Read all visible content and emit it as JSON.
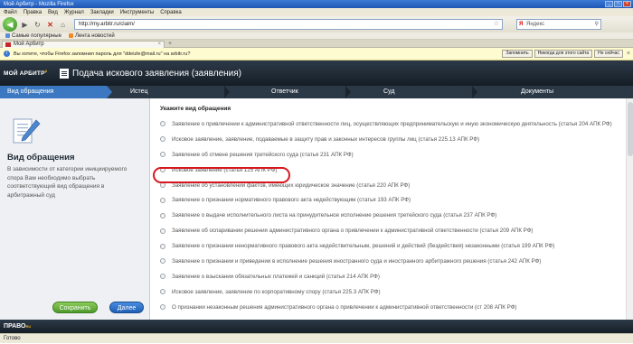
{
  "browser": {
    "window_title": "Мой Арбитр - Mozilla Firefox",
    "menu": [
      "Файл",
      "Правка",
      "Вид",
      "Журнал",
      "Закладки",
      "Инструменты",
      "Справка"
    ],
    "url": "http://my.arbitr.ru/claim/",
    "search_engine": "Яндекс",
    "bookmarks": [
      "Самые популярные",
      "Лента новостей"
    ],
    "tab_title": "Мой Арбитр",
    "notification": {
      "text": "Вы хотите, чтобы Firefox запомнил пароль для \"ddeizle@mail.ru\" на arbitr.ru?",
      "buttons": [
        "Запомнить",
        "Никогда для этого сайта",
        "Не сейчас"
      ]
    },
    "status": "Готово"
  },
  "site": {
    "logo": "МОЙ АРБИТР",
    "logo_badge": "β",
    "page_title": "Подача искового заявления (заявления)",
    "footer_logo": "ПРАВО",
    "footer_badge": "RU"
  },
  "steps": [
    "Вид обращения",
    "Истец",
    "Ответчик",
    "Суд",
    "Документы"
  ],
  "left_panel": {
    "title": "Вид обращения",
    "description": "В зависимости от категории инициируемого спора Вам необходимо выбрать соответствующий вид обращения в арбитражный суд",
    "save_label": "Сохранить",
    "next_label": "Далее"
  },
  "main": {
    "heading": "Укажите вид обращения",
    "options": [
      "Заявление о привлечении к административной ответственности лиц, осуществляющих предпринимательскую и иную экономическую деятельность (статья 204 АПК РФ)",
      "Исковое заявление, заявление, подаваемые в защиту прав и законных интересов группы лиц (статья 225.13 АПК РФ)",
      "Заявление об отмене решения третейского суда (статья 231 АПК РФ)",
      "Исковое заявление (статья 125 АПК РФ)",
      "Заявление об установлении фактов, имеющих юридическое значение (статья 220 АПК РФ)",
      "Заявление о признании нормативного правового акта недействующим (статья 193 АПК РФ)",
      "Заявление о выдаче исполнительного листа на принудительное исполнение решения третейского суда (статья 237 АПК РФ)",
      "Заявление об оспаривании решения административного органа о привлечении к административной ответственности (статья 209 АПК РФ)",
      "Заявление о признании ненормативного правового акта недействительным, решений и действий (бездействия) незаконными (статья 199 АПК РФ)",
      "Заявление о признании и приведении в исполнение решения иностранного суда и иностранного арбитражного решения (статья 242 АПК РФ)",
      "Заявление о взыскании обязательных платежей и санкций (статья 214 АПК РФ)",
      "Исковое заявление, заявление по корпоративному спору (статья 225.3 АПК РФ)",
      "О признании незаконным решения административного органа о привлечении к административной ответственности (ст 208 АПК РФ)"
    ]
  },
  "colors": {
    "header_dark": "#1e2833",
    "step_active": "#3c78c1",
    "save_green": "#5aa532",
    "next_blue": "#2c6fc7",
    "highlight_red": "#d6171e"
  }
}
